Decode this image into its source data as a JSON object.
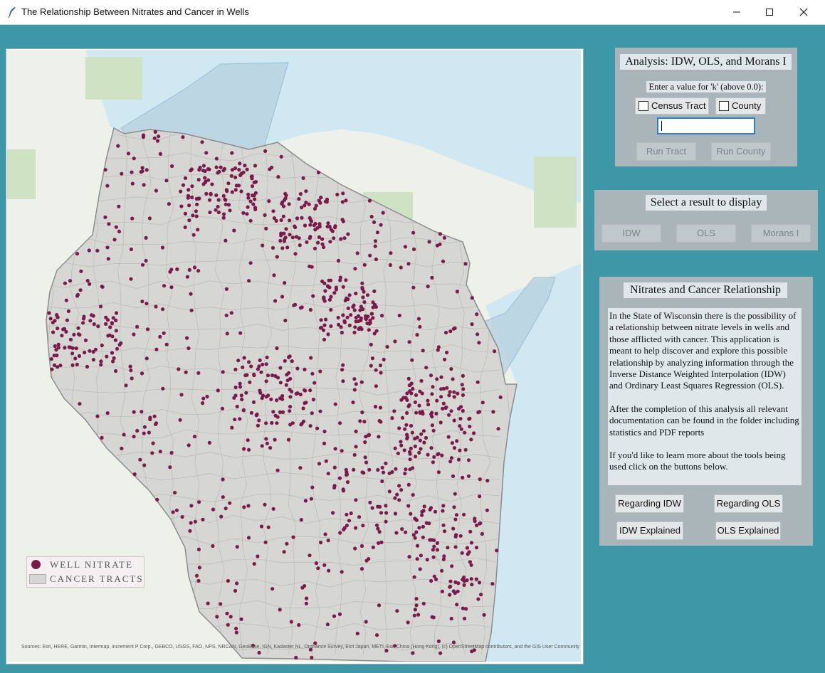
{
  "window": {
    "title": "The Relationship Between Nitrates and Cancer in Wells",
    "controls": [
      "minimize-icon",
      "maximize-icon",
      "close-icon"
    ]
  },
  "map": {
    "legend": {
      "well_label": "WELL NITRATE",
      "tract_label": "CANCER TRACTS"
    },
    "attribution": "Sources: Esri, HERE, Garmin, Intermap, increment P Corp., GEBCO, USGS, FAO, NPS, NRCAN, GeoBase, IGN, Kadaster NL, Ordnance Survey, Esri Japan, METI, Esri China (Hong Kong), (c) OpenStreetMap contributors, and the GIS User Community",
    "colors": {
      "water": "#cfe8f1",
      "land": "#eef0ea",
      "state": "#d6d7d4",
      "well": "#7a1a46"
    }
  },
  "analysis": {
    "title": "Analysis: IDW, OLS, and Morans I",
    "prompt": "Enter a value for 'k' (above 0.0):",
    "census_tract_label": "Census Tract",
    "county_label": "County",
    "k_value": "",
    "run_tract_label": "Run Tract",
    "run_county_label": "Run County"
  },
  "results": {
    "title": "Select a result to display",
    "idw_label": "IDW",
    "ols_label": "OLS",
    "morans_label": "Morans I"
  },
  "info": {
    "title": "Nitrates and Cancer Relationship",
    "paragraph1": "In the State of Wisconsin there is the possibility of a relationship between nitrate levels in wells and those afflicted with cancer. This application is meant to help discover and explore this possible relationship by analyzing information through the Inverse Distance Weighted Interpolation (IDW) and Ordinary Least Squares Regression (OLS).",
    "paragraph2": "After the completion of this analysis all relevant documentation can be found in the folder including statistics and PDF reports",
    "paragraph3": " If you'd like to learn more about the tools being used click on the buttons below.",
    "regarding_idw_label": "Regarding IDW",
    "regarding_ols_label": "Regarding OLS",
    "idw_explained_label": "IDW Explained",
    "ols_explained_label": "OLS Explained"
  },
  "colors": {
    "background": "#3d97a6",
    "panel": "#a9b5b9",
    "panel_label": "#dfe7ea"
  }
}
